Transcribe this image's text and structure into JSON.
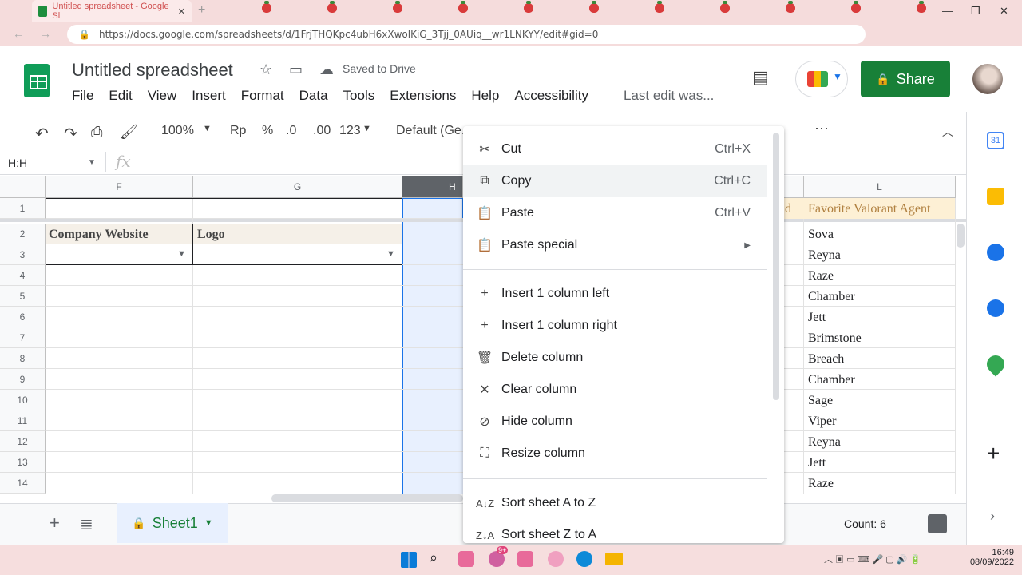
{
  "browser": {
    "tab_title": "Untitled spreadsheet - Google Sl",
    "url": "https://docs.google.com/spreadsheets/d/1FrjTHQKpc4ubH6xXwolKiG_3Tjj_0AUiq__wr1LNKYY/edit#gid=0"
  },
  "doc": {
    "title": "Untitled spreadsheet",
    "saved_status": "Saved to Drive",
    "last_edit": "Last edit was...",
    "share_label": "Share"
  },
  "menu": [
    "File",
    "Edit",
    "View",
    "Insert",
    "Format",
    "Data",
    "Tools",
    "Extensions",
    "Help",
    "Accessibility"
  ],
  "toolbar": {
    "zoom": "100%",
    "currency": "Rp",
    "percent": "%",
    "dec_less": ".0",
    "dec_more": ".00",
    "format": "123",
    "font": "Default (Ge..."
  },
  "formula": {
    "namebox": "H:H",
    "fx": "fx"
  },
  "columns": {
    "F": "F",
    "G": "G",
    "H": "H",
    "L": "L"
  },
  "rows": [
    "1",
    "2",
    "3",
    "4",
    "5",
    "6",
    "7",
    "8",
    "9",
    "10",
    "11",
    "12",
    "13",
    "14"
  ],
  "cells": {
    "F2": "Company Website",
    "G2": "Logo",
    "K1_partial": "d",
    "L1": "Favorite Valorant Agent",
    "L_values": [
      "Sova",
      "Reyna",
      "Raze",
      "Chamber",
      "Jett",
      "Brimstone",
      "Breach",
      "Chamber",
      "Sage",
      "Viper",
      "Reyna",
      "Jett",
      "Raze"
    ]
  },
  "context_menu": {
    "cut": {
      "label": "Cut",
      "shortcut": "Ctrl+X"
    },
    "copy": {
      "label": "Copy",
      "shortcut": "Ctrl+C"
    },
    "paste": {
      "label": "Paste",
      "shortcut": "Ctrl+V"
    },
    "paste_special": {
      "label": "Paste special"
    },
    "insert_left": {
      "label": "Insert 1 column left"
    },
    "insert_right": {
      "label": "Insert 1 column right"
    },
    "delete_col": {
      "label": "Delete column"
    },
    "clear_col": {
      "label": "Clear column"
    },
    "hide_col": {
      "label": "Hide column"
    },
    "resize_col": {
      "label": "Resize column"
    },
    "sort_az": {
      "label": "Sort sheet A to Z"
    },
    "sort_za": {
      "label": "Sort sheet Z to A"
    }
  },
  "sheet": {
    "name": "Sheet1",
    "count": "Count: 6"
  },
  "taskbar": {
    "time": "16:49",
    "date": "08/09/2022",
    "badge": "9+"
  },
  "colors": {
    "green": "#188038",
    "header_fill": "#fdf0d5",
    "selected": "#e8f0fe"
  }
}
